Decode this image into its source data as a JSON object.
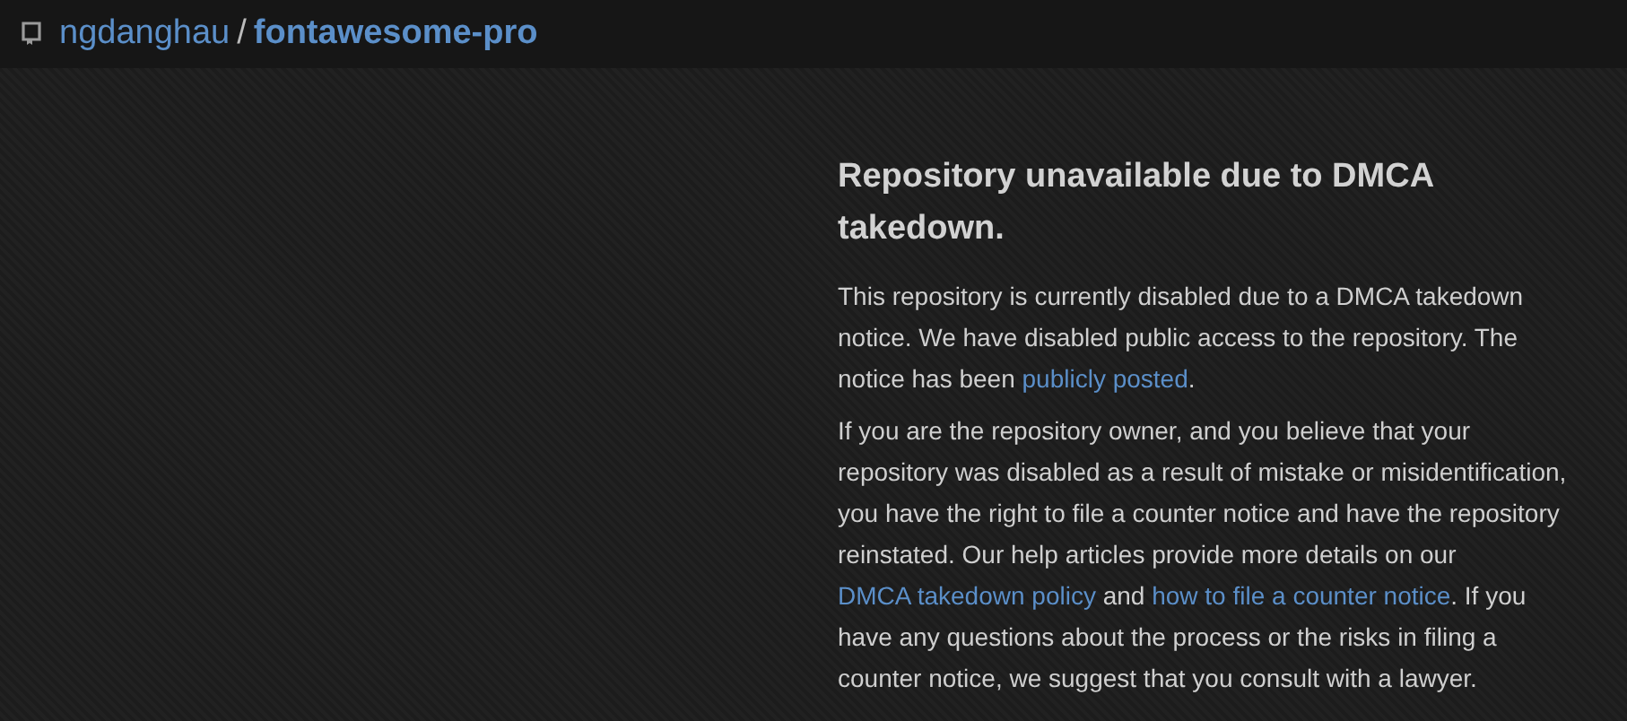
{
  "breadcrumb": {
    "owner": "ngdanghau",
    "separator": "/",
    "repo": "fontawesome-pro"
  },
  "notice": {
    "title": "Repository unavailable due to DMCA takedown.",
    "paragraphs": [
      [
        {
          "kind": "text",
          "text": "This repository is currently disabled due to a DMCA takedown notice. We have disabled public access to the repository. The notice has been "
        },
        {
          "kind": "link",
          "text": "publicly posted"
        },
        {
          "kind": "text",
          "text": "."
        }
      ],
      [
        {
          "kind": "text",
          "text": "If you are the repository owner, and you believe that your repository was disabled as a result of mistake or misidentification, you have the right to file a counter notice and have the repository reinstated. Our help articles provide more details on our "
        },
        {
          "kind": "link",
          "text": "DMCA takedown policy"
        },
        {
          "kind": "text",
          "text": " and "
        },
        {
          "kind": "link",
          "text": "how to file a counter notice"
        },
        {
          "kind": "text",
          "text": ". If you have any questions about the process or the risks in filing a counter notice, we suggest that you consult with a lawyer."
        }
      ]
    ]
  }
}
